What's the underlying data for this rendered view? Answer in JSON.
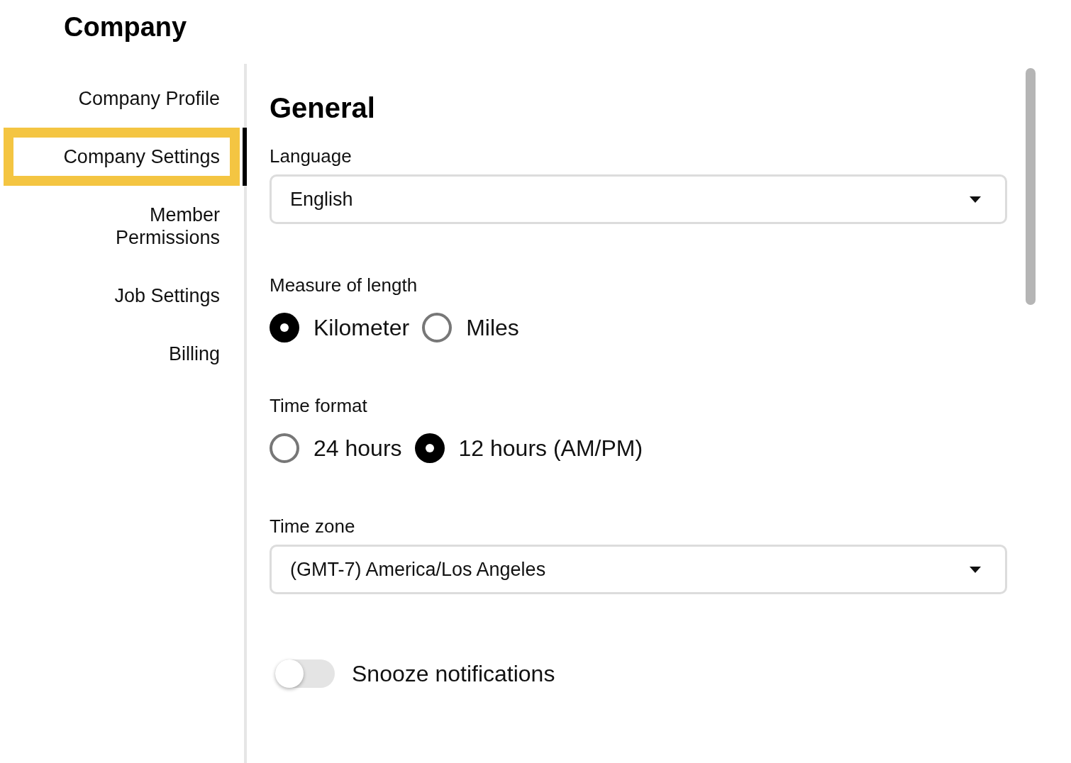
{
  "title": "Company",
  "sidebar": {
    "items": [
      {
        "label": "Company Profile",
        "selected": false
      },
      {
        "label": "Company Settings",
        "selected": true
      },
      {
        "label": "Member Permissions",
        "selected": false
      },
      {
        "label": "Job Settings",
        "selected": false
      },
      {
        "label": "Billing",
        "selected": false
      }
    ]
  },
  "section": {
    "heading": "General",
    "fields": [
      {
        "kind": "select",
        "label": "Language",
        "value": "English"
      },
      {
        "kind": "radio",
        "label": "Measure of length",
        "options": [
          {
            "label": "Kilometer",
            "selected": true
          },
          {
            "label": "Miles",
            "selected": false
          }
        ]
      },
      {
        "kind": "radio",
        "label": "Time format",
        "options": [
          {
            "label": "24 hours",
            "selected": false
          },
          {
            "label": "12 hours (AM/PM)",
            "selected": true
          }
        ]
      },
      {
        "kind": "select",
        "label": "Time zone",
        "value": "(GMT-7) America/Los Angeles"
      },
      {
        "kind": "toggle",
        "label": "Snooze notifications",
        "on": false
      }
    ]
  }
}
